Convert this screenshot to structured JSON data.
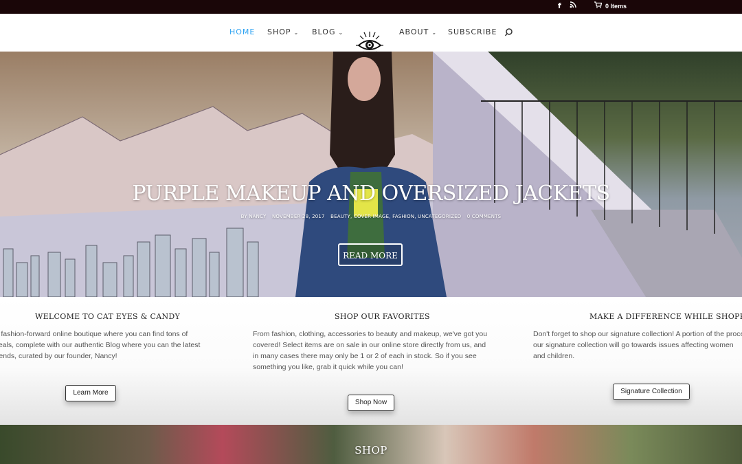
{
  "topbar": {
    "facebook_icon": "f",
    "rss_icon": "rss",
    "cart_icon": "cart",
    "cart_label": "0 Items"
  },
  "nav": {
    "items": [
      {
        "label": "HOME",
        "active": true
      },
      {
        "label": "SHOP",
        "dropdown": true
      },
      {
        "label": "BLOG",
        "dropdown": true
      },
      {
        "label": "ABOUT",
        "dropdown": true
      },
      {
        "label": "SUBSCRIBE"
      }
    ],
    "search_icon": "search-icon",
    "accent": "#2ea3f2"
  },
  "hero": {
    "title": "PURPLE MAKEUP AND OVERSIZED JACKETS",
    "meta": {
      "author": "BY NANCY",
      "date": "NOVEMBER 28, 2017",
      "categories": "BEAUTY, COVER IMAGE, FASHION, UNCATEGORIZED",
      "comments": "0 COMMENTS"
    },
    "button": "READ MORE",
    "slides": 5,
    "active_slide": 2
  },
  "features": [
    {
      "title": "WELCOME TO CAT EYES & CANDY",
      "text": "A fashion-forward online boutique where you can find tons of deals, complete with our authentic Blog where you can the latest trends, curated by our founder, Nancy!",
      "button": "Learn More"
    },
    {
      "title": "SHOP OUR FAVORITES",
      "text": "From fashion, clothing, accessories to beauty and makeup, we've got you covered! Select items are on sale in our online store directly from us, and in many cases there may only be 1 or 2 of each in stock. So if you see something you like, grab it quick while you can!",
      "button": "Shop Now"
    },
    {
      "title": "MAKE A DIFFERENCE WHILE SHOPPING",
      "text": "Don't forget to shop our signature collection!  A portion of the proce our signature collection will go towards issues affecting women and children.",
      "button": "Signature Collection"
    }
  ],
  "shop": {
    "title": "SHOP"
  }
}
